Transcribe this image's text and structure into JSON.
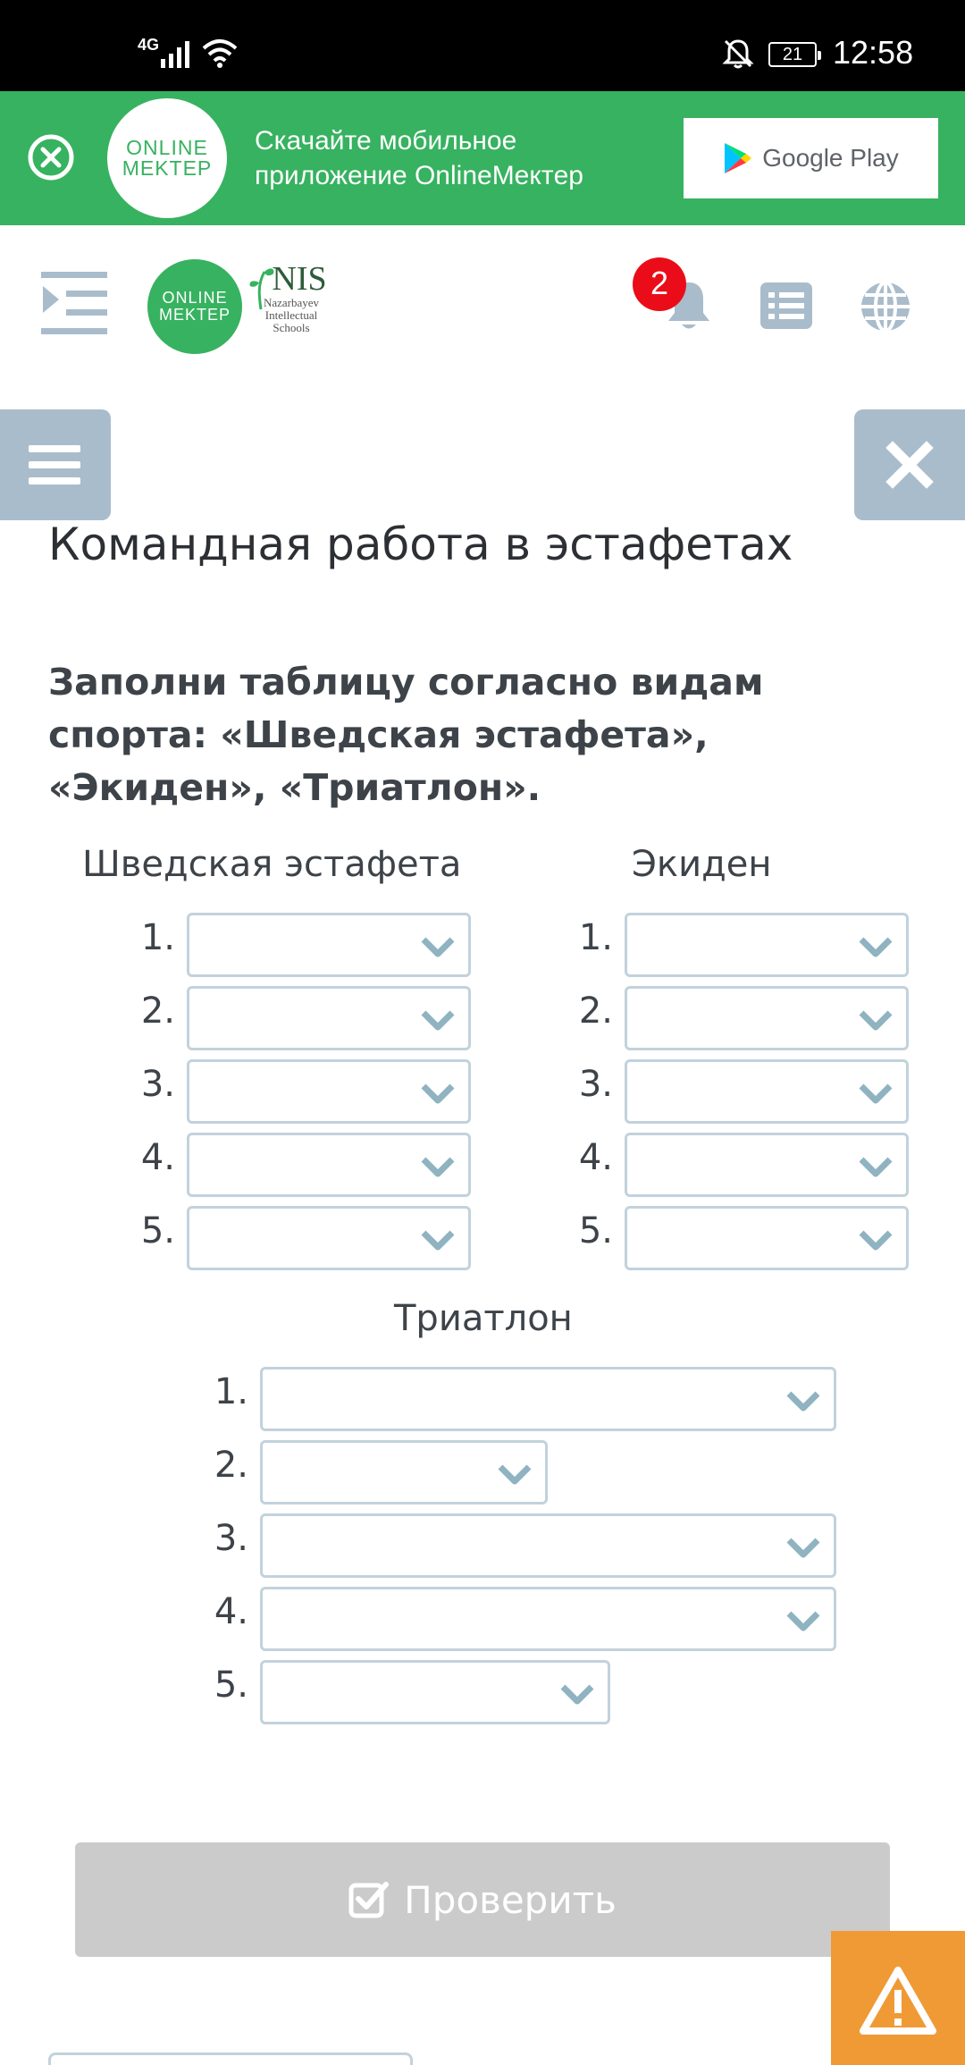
{
  "status_bar": {
    "network": "4G",
    "battery": "21",
    "time": "12:58"
  },
  "banner": {
    "logo_line1": "ONLINE",
    "logo_line2": "MEKTEP",
    "text": "Скачайте мобильное приложение OnlineMeктep",
    "store_label": "Google Play",
    "brand_color": "#37b260"
  },
  "header": {
    "logo_line1": "ONLINE",
    "logo_line2": "MEKTEP",
    "nis_title": "NIS",
    "nis_line1": "Nazarbayev",
    "nis_line2": "Intellectual",
    "nis_line3": "Schools",
    "notification_count": "2"
  },
  "task": {
    "title": "Командная работа в эстафетах",
    "instruction": "Заполни таблицу согласно видам спорта: «Шведская эстафета», «Экиден», «Триатлон».",
    "columns": [
      {
        "title": "Шведская эстафета",
        "rows": [
          {
            "num": "1.",
            "value": ""
          },
          {
            "num": "2.",
            "value": ""
          },
          {
            "num": "3.",
            "value": ""
          },
          {
            "num": "4.",
            "value": ""
          },
          {
            "num": "5.",
            "value": ""
          }
        ]
      },
      {
        "title": "Экиден",
        "rows": [
          {
            "num": "1.",
            "value": ""
          },
          {
            "num": "2.",
            "value": ""
          },
          {
            "num": "3.",
            "value": ""
          },
          {
            "num": "4.",
            "value": ""
          },
          {
            "num": "5.",
            "value": ""
          }
        ]
      },
      {
        "title": "Триатлон",
        "rows": [
          {
            "num": "1.",
            "value": ""
          },
          {
            "num": "2.",
            "value": ""
          },
          {
            "num": "3.",
            "value": ""
          },
          {
            "num": "4.",
            "value": ""
          },
          {
            "num": "5.",
            "value": ""
          }
        ]
      }
    ],
    "check_label": "Проверить"
  },
  "colors": {
    "accent_green": "#37b260",
    "panel_gray_blue": "#a9bccb",
    "dropdown_border": "#c2d2dc",
    "chevron": "#8fb3c0",
    "badge_red": "#ea0d19",
    "warning_orange": "#f09a36",
    "check_disabled": "#cbcbcb"
  },
  "icons": [
    "signal-icon",
    "wifi-icon",
    "bell-off-icon",
    "battery-icon",
    "close-circle-icon",
    "google-play-icon",
    "indent-menu-icon",
    "bell-icon",
    "list-icon",
    "globe-icon",
    "hamburger-icon",
    "close-icon",
    "chevron-down-icon",
    "checkbox-icon",
    "warning-icon"
  ]
}
